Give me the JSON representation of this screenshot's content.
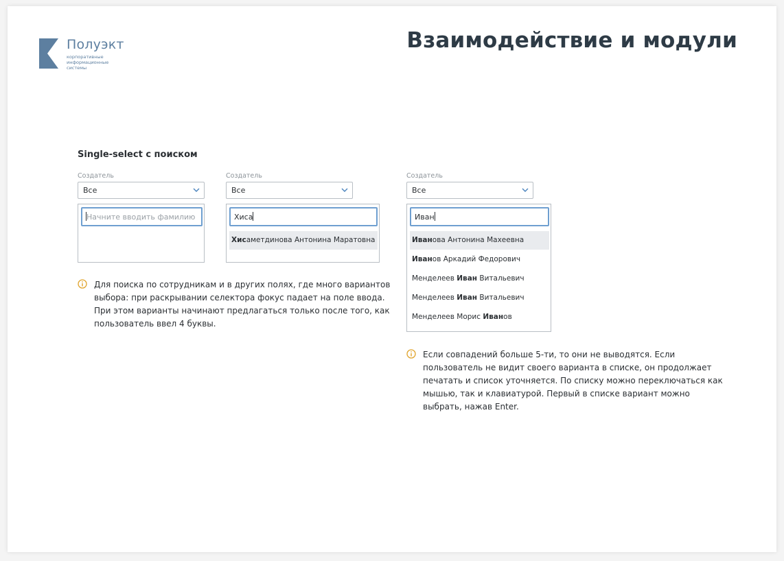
{
  "brand": {
    "name": "Полуэкт",
    "tagline": [
      "корпоративные",
      "информационные",
      "системы"
    ]
  },
  "page_title": "Взаимодействие и модули",
  "section_title": "Single-select с поиском",
  "selectors": [
    {
      "label": "Создатель",
      "value": "Все",
      "search_value": "",
      "search_placeholder": "Начните вводить фамилию",
      "options": []
    },
    {
      "label": "Создатель",
      "value": "Все",
      "search_value": "Хиса",
      "options": [
        {
          "match": "Хис",
          "rest": "аметдинова Антонина Маратовна"
        }
      ]
    },
    {
      "label": "Создатель",
      "value": "Все",
      "search_value": "Иван",
      "options": [
        {
          "before": "",
          "match": "Иван",
          "after": "ова Антонина Махеевна"
        },
        {
          "before": "",
          "match": "Иван",
          "after": "ов Аркадий Федорович"
        },
        {
          "before": "Менделеев ",
          "match": "Иван",
          "after": " Витальевич"
        },
        {
          "before": "Менделеев ",
          "match": "Иван",
          "after": " Витальевич"
        },
        {
          "before": "Менделеев Морис ",
          "match": "Иван",
          "after": "ов"
        }
      ]
    }
  ],
  "notes": [
    {
      "icon": "info-icon",
      "lines": [
        "Для поиска по сотрудникам и в других полях, где много вариантов",
        "выбора: при раскрывании селектора фокус падает на поле ввода.",
        "При этом варианты начинают предлагаться только после того, как",
        "пользователь ввел 4 буквы."
      ]
    },
    {
      "icon": "info-icon",
      "lines": [
        "Если совпадений больше 5-ти, то они не выводятся. Если",
        "пользователь не видит своего варианта в списке, он продолжает",
        "печатать и список уточняется. По списку можно переключаться как",
        "мышью, так и клавиатурой. Первый в списке вариант можно",
        "выбрать, нажав Enter."
      ]
    }
  ],
  "colors": {
    "accent": "#6e9fd0",
    "brand": "#5d7fa0",
    "info": "#e0a32a",
    "highlight": "#e9ebee"
  }
}
